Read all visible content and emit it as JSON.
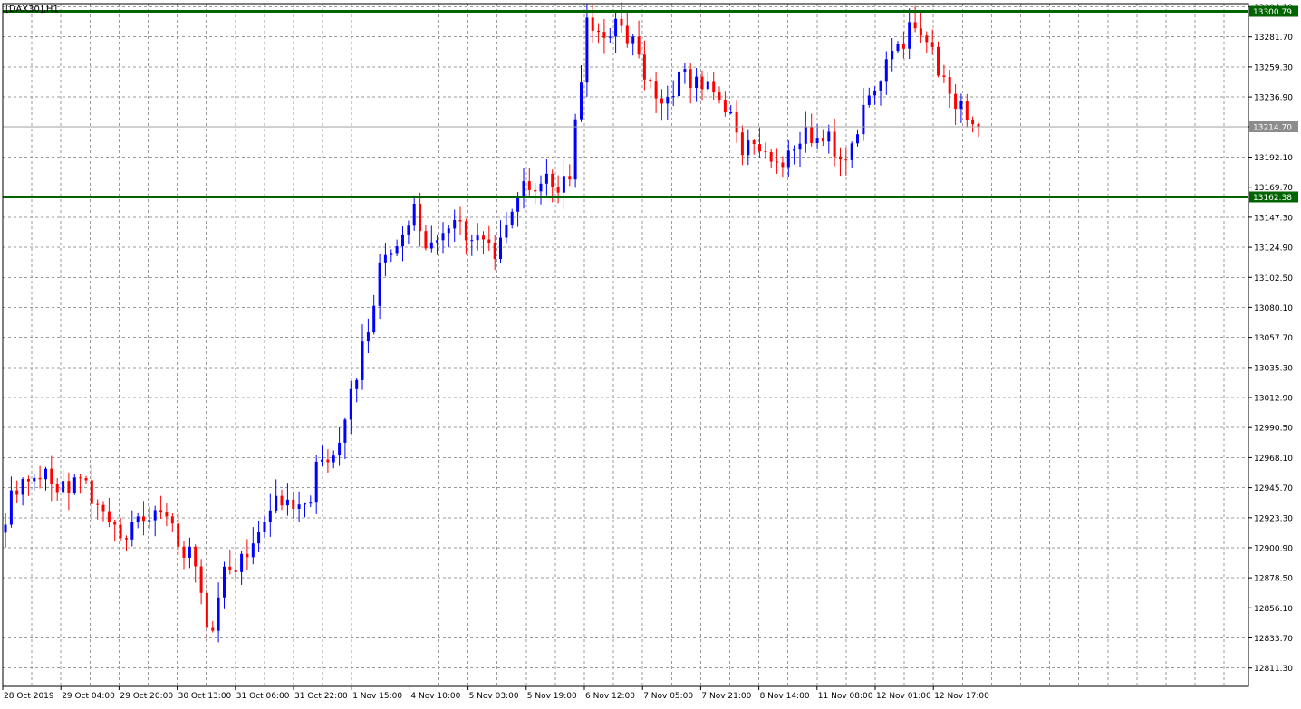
{
  "window": {
    "title": "[DAX30],H1"
  },
  "colors": {
    "background": "#ffffff",
    "grid": "#9a9a9a",
    "bull": "#0000ff",
    "bear": "#ff0000",
    "level_line": "#006400",
    "current_price_line": "#a0a0a0",
    "current_price_tag": "#8c8c8c"
  },
  "chart_data": {
    "type": "candlestick",
    "title": "[DAX30],H1",
    "ylim": [
      12797.6,
      13306.5
    ],
    "grid": true,
    "x_labels": [
      "28 Oct 2019",
      "29 Oct 04:00",
      "29 Oct 20:00",
      "30 Oct 13:00",
      "31 Oct 06:00",
      "31 Oct 22:00",
      "1 Nov 15:00",
      "4 Nov 10:00",
      "5 Nov 03:00",
      "5 Nov 19:00",
      "6 Nov 12:00",
      "7 Nov 05:00",
      "7 Nov 21:00",
      "8 Nov 14:00",
      "11 Nov 08:00",
      "12 Nov 01:00",
      "12 Nov 17:00"
    ],
    "y_tick_labels": [
      "13304.10",
      "13281.70",
      "13259.30",
      "13236.90",
      "13214.70",
      "13192.10",
      "13169.70",
      "13147.30",
      "13124.90",
      "13102.50",
      "13080.10",
      "13057.70",
      "13035.30",
      "13012.90",
      "12990.50",
      "12968.10",
      "12945.70",
      "12923.30",
      "12900.90",
      "12878.50",
      "12856.10",
      "12833.70",
      "12811.30"
    ],
    "horizontal_levels": [
      {
        "price": 13300.79,
        "label": "13300.79"
      },
      {
        "price": 13162.38,
        "label": "13162.38"
      }
    ],
    "current_price": {
      "price": 13214.7,
      "label": "13214.70"
    },
    "close_anchors": [
      12925,
      12955,
      12960,
      12950,
      12945,
      12950,
      12930,
      12915,
      12915,
      12920,
      12930,
      12902,
      12893,
      12835,
      12890,
      12890,
      12905,
      12935,
      12935,
      12925,
      12965,
      12975,
      13015,
      13060,
      13115,
      13125,
      13160,
      13120,
      13135,
      13140,
      13130,
      13120,
      13140,
      13170,
      13175,
      13170,
      13180,
      13290,
      13285,
      13290,
      13275,
      13245,
      13230,
      13255,
      13250,
      13245,
      13230,
      13200,
      13195,
      13180,
      13200,
      13210,
      13210,
      13195,
      13200,
      13240,
      13260,
      13275,
      13295,
      13270,
      13240,
      13230,
      13214.7
    ]
  }
}
